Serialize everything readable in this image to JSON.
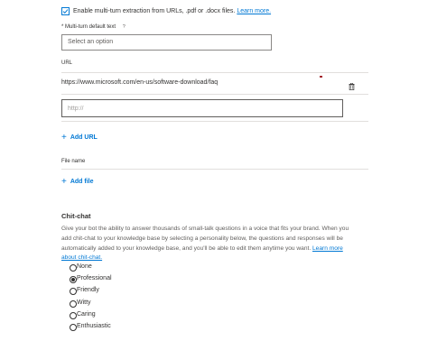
{
  "multiturn": {
    "checkbox_label": "Enable multi-turn extraction from URLs, .pdf or .docx files.",
    "learn_more": "Learn more.",
    "checked": true
  },
  "default_text": {
    "label": "* Multi-turn default text",
    "help_icon": "?",
    "placeholder": "Select an option"
  },
  "url_section": {
    "header": "URL",
    "items": [
      {
        "url": "https://www.microsoft.com/en-us/software-download/faq"
      }
    ],
    "delete_icon": "trash-icon",
    "input_placeholder": "http://",
    "add_label": "Add URL"
  },
  "file_section": {
    "header": "File name",
    "add_label": "Add file"
  },
  "chitchat": {
    "title": "Chit-chat",
    "description": "Give your bot the ability to answer thousands of small-talk questions in a voice that fits your brand. When you add chit-chat to your knowledge base by selecting a personality below, the questions and responses will be automatically added to your knowledge base, and you'll be able to edit them anytime you want.",
    "learn_more": "Learn more about chit-chat.",
    "options": [
      "None",
      "Professional",
      "Friendly",
      "Witty",
      "Caring",
      "Enthusiastic"
    ],
    "selected": "Professional"
  },
  "colors": {
    "accent": "#0078d4",
    "required": "#a4262c"
  }
}
